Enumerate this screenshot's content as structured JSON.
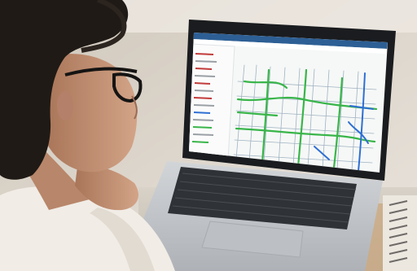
{
  "photo": {
    "subject": "person",
    "device": "laptop",
    "screen_app": "road-map-viewer",
    "palette": {
      "wall": "#d7d0c6",
      "shelf": "#eee9e2",
      "hair": "#1f1a16",
      "skin": "#c9977a",
      "sweater": "#f1ece6",
      "laptop_body": "#c5c8cc",
      "laptop_bezel": "#1a1c1f",
      "keyboard": "#2d3034",
      "screen_header": "#2d5f95",
      "map_background": "#f6f8f7",
      "road_green": "#39b54a",
      "road_blue": "#2f6fd3",
      "notebook": "#e9e4dc"
    }
  }
}
